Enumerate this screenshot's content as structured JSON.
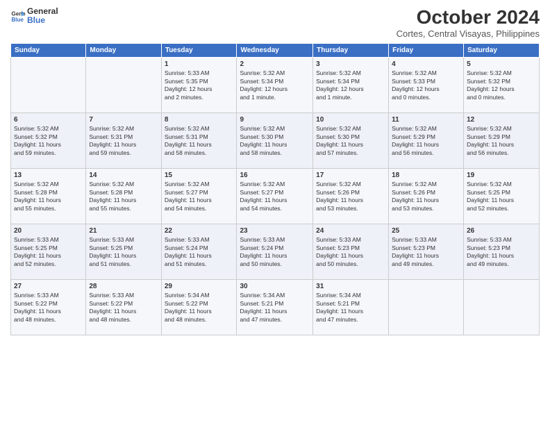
{
  "logo": {
    "line1": "General",
    "line2": "Blue"
  },
  "title": "October 2024",
  "subtitle": "Cortes, Central Visayas, Philippines",
  "days_header": [
    "Sunday",
    "Monday",
    "Tuesday",
    "Wednesday",
    "Thursday",
    "Friday",
    "Saturday"
  ],
  "weeks": [
    [
      {
        "day": "",
        "content": ""
      },
      {
        "day": "",
        "content": ""
      },
      {
        "day": "1",
        "content": "Sunrise: 5:33 AM\nSunset: 5:35 PM\nDaylight: 12 hours\nand 2 minutes."
      },
      {
        "day": "2",
        "content": "Sunrise: 5:32 AM\nSunset: 5:34 PM\nDaylight: 12 hours\nand 1 minute."
      },
      {
        "day": "3",
        "content": "Sunrise: 5:32 AM\nSunset: 5:34 PM\nDaylight: 12 hours\nand 1 minute."
      },
      {
        "day": "4",
        "content": "Sunrise: 5:32 AM\nSunset: 5:33 PM\nDaylight: 12 hours\nand 0 minutes."
      },
      {
        "day": "5",
        "content": "Sunrise: 5:32 AM\nSunset: 5:32 PM\nDaylight: 12 hours\nand 0 minutes."
      }
    ],
    [
      {
        "day": "6",
        "content": "Sunrise: 5:32 AM\nSunset: 5:32 PM\nDaylight: 11 hours\nand 59 minutes."
      },
      {
        "day": "7",
        "content": "Sunrise: 5:32 AM\nSunset: 5:31 PM\nDaylight: 11 hours\nand 59 minutes."
      },
      {
        "day": "8",
        "content": "Sunrise: 5:32 AM\nSunset: 5:31 PM\nDaylight: 11 hours\nand 58 minutes."
      },
      {
        "day": "9",
        "content": "Sunrise: 5:32 AM\nSunset: 5:30 PM\nDaylight: 11 hours\nand 58 minutes."
      },
      {
        "day": "10",
        "content": "Sunrise: 5:32 AM\nSunset: 5:30 PM\nDaylight: 11 hours\nand 57 minutes."
      },
      {
        "day": "11",
        "content": "Sunrise: 5:32 AM\nSunset: 5:29 PM\nDaylight: 11 hours\nand 56 minutes."
      },
      {
        "day": "12",
        "content": "Sunrise: 5:32 AM\nSunset: 5:29 PM\nDaylight: 11 hours\nand 56 minutes."
      }
    ],
    [
      {
        "day": "13",
        "content": "Sunrise: 5:32 AM\nSunset: 5:28 PM\nDaylight: 11 hours\nand 55 minutes."
      },
      {
        "day": "14",
        "content": "Sunrise: 5:32 AM\nSunset: 5:28 PM\nDaylight: 11 hours\nand 55 minutes."
      },
      {
        "day": "15",
        "content": "Sunrise: 5:32 AM\nSunset: 5:27 PM\nDaylight: 11 hours\nand 54 minutes."
      },
      {
        "day": "16",
        "content": "Sunrise: 5:32 AM\nSunset: 5:27 PM\nDaylight: 11 hours\nand 54 minutes."
      },
      {
        "day": "17",
        "content": "Sunrise: 5:32 AM\nSunset: 5:26 PM\nDaylight: 11 hours\nand 53 minutes."
      },
      {
        "day": "18",
        "content": "Sunrise: 5:32 AM\nSunset: 5:26 PM\nDaylight: 11 hours\nand 53 minutes."
      },
      {
        "day": "19",
        "content": "Sunrise: 5:32 AM\nSunset: 5:25 PM\nDaylight: 11 hours\nand 52 minutes."
      }
    ],
    [
      {
        "day": "20",
        "content": "Sunrise: 5:33 AM\nSunset: 5:25 PM\nDaylight: 11 hours\nand 52 minutes."
      },
      {
        "day": "21",
        "content": "Sunrise: 5:33 AM\nSunset: 5:25 PM\nDaylight: 11 hours\nand 51 minutes."
      },
      {
        "day": "22",
        "content": "Sunrise: 5:33 AM\nSunset: 5:24 PM\nDaylight: 11 hours\nand 51 minutes."
      },
      {
        "day": "23",
        "content": "Sunrise: 5:33 AM\nSunset: 5:24 PM\nDaylight: 11 hours\nand 50 minutes."
      },
      {
        "day": "24",
        "content": "Sunrise: 5:33 AM\nSunset: 5:23 PM\nDaylight: 11 hours\nand 50 minutes."
      },
      {
        "day": "25",
        "content": "Sunrise: 5:33 AM\nSunset: 5:23 PM\nDaylight: 11 hours\nand 49 minutes."
      },
      {
        "day": "26",
        "content": "Sunrise: 5:33 AM\nSunset: 5:23 PM\nDaylight: 11 hours\nand 49 minutes."
      }
    ],
    [
      {
        "day": "27",
        "content": "Sunrise: 5:33 AM\nSunset: 5:22 PM\nDaylight: 11 hours\nand 48 minutes."
      },
      {
        "day": "28",
        "content": "Sunrise: 5:33 AM\nSunset: 5:22 PM\nDaylight: 11 hours\nand 48 minutes."
      },
      {
        "day": "29",
        "content": "Sunrise: 5:34 AM\nSunset: 5:22 PM\nDaylight: 11 hours\nand 48 minutes."
      },
      {
        "day": "30",
        "content": "Sunrise: 5:34 AM\nSunset: 5:21 PM\nDaylight: 11 hours\nand 47 minutes."
      },
      {
        "day": "31",
        "content": "Sunrise: 5:34 AM\nSunset: 5:21 PM\nDaylight: 11 hours\nand 47 minutes."
      },
      {
        "day": "",
        "content": ""
      },
      {
        "day": "",
        "content": ""
      }
    ]
  ]
}
